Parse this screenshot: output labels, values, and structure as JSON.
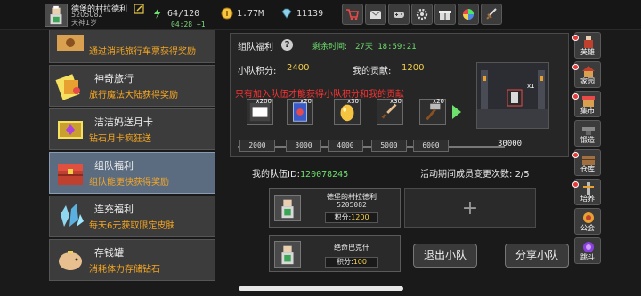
{
  "player": {
    "name": "德堡的村拉德利",
    "id": "5205082",
    "sub": "天神1岁",
    "timer": "04:28 +1"
  },
  "resources": [
    {
      "icon": "energy-icon",
      "value": "64/120"
    },
    {
      "icon": "gold-coin-icon",
      "value": "1.77M"
    },
    {
      "icon": "gem-icon",
      "value": "11139"
    }
  ],
  "menu": [
    {
      "title": "",
      "desc": "通过消耗旅行车票获得奖励",
      "icon": "ticket-icon"
    },
    {
      "title": "神奇旅行",
      "desc": "旅行魔法大陆获得奖励",
      "icon": "magic-travel-icon"
    },
    {
      "title": "洁洁妈送月卡",
      "desc": "钻石月卡疯狂送",
      "icon": "monthly-card-icon"
    },
    {
      "title": "组队福利",
      "desc": "组队能更快获得奖励",
      "icon": "team-chest-icon"
    },
    {
      "title": "连充福利",
      "desc": "每天6元获取限定皮肤",
      "icon": "crystal-icon"
    },
    {
      "title": "存钱罐",
      "desc": "消耗体力存储钻石",
      "icon": "piggy-bank-icon"
    }
  ],
  "team": {
    "title": "组队福利",
    "remaining_label": "剩余时间:",
    "remaining_value": "27天 18:59:21",
    "points_label": "小队积分:",
    "points_value": "2400",
    "contribution_label": "我的贡献:",
    "contribution_value": "1200",
    "note": "只有加入队伍才能获得小队积分和我的贡献",
    "rewards": [
      {
        "name": "badge-reward-icon",
        "count": "x200"
      },
      {
        "name": "blue-card-icon",
        "count": "x20"
      },
      {
        "name": "golden-egg-icon",
        "count": "x30"
      },
      {
        "name": "dagger-icon",
        "count": "x30"
      },
      {
        "name": "hammer-icon",
        "count": "x20"
      }
    ],
    "milestones": [
      "2000",
      "3000",
      "4000",
      "5000",
      "6000"
    ],
    "milestone_final": "30000",
    "scene_count": "x1",
    "team_id_label": "我的队伍ID:",
    "team_id_value": "120078245",
    "changes_label": "活动期间成员变更次数:",
    "changes_value": "2/5",
    "members": [
      {
        "name": "德堡的村拉德利",
        "id": "5205082",
        "score_label": "积分:",
        "score": "1200"
      },
      {
        "name": "绝命巴克什",
        "id": "",
        "score_label": "积分:",
        "score": "100"
      }
    ],
    "add_symbol": "+",
    "leave_label": "退出小队",
    "share_label": "分享小队"
  },
  "right_buttons": [
    {
      "label": "英雄",
      "icon": "hero-icon",
      "dot": true
    },
    {
      "label": "家园",
      "icon": "home-icon",
      "dot": true
    },
    {
      "label": "集市",
      "icon": "market-icon",
      "dot": true
    },
    {
      "label": "锻造",
      "icon": "anvil-icon",
      "dot": false
    },
    {
      "label": "仓库",
      "icon": "warehouse-icon",
      "dot": true
    },
    {
      "label": "培养",
      "icon": "train-icon",
      "dot": true
    },
    {
      "label": "公会",
      "icon": "guild-icon",
      "dot": false
    },
    {
      "label": "跳斗",
      "icon": "portal-icon",
      "dot": false
    }
  ],
  "colors": {
    "accent_orange": "#f5a623",
    "accent_yellow": "#f5d04a",
    "accent_green": "#6ee06e",
    "warning_red": "#ff3333",
    "active_blue": "#5c6c80"
  }
}
